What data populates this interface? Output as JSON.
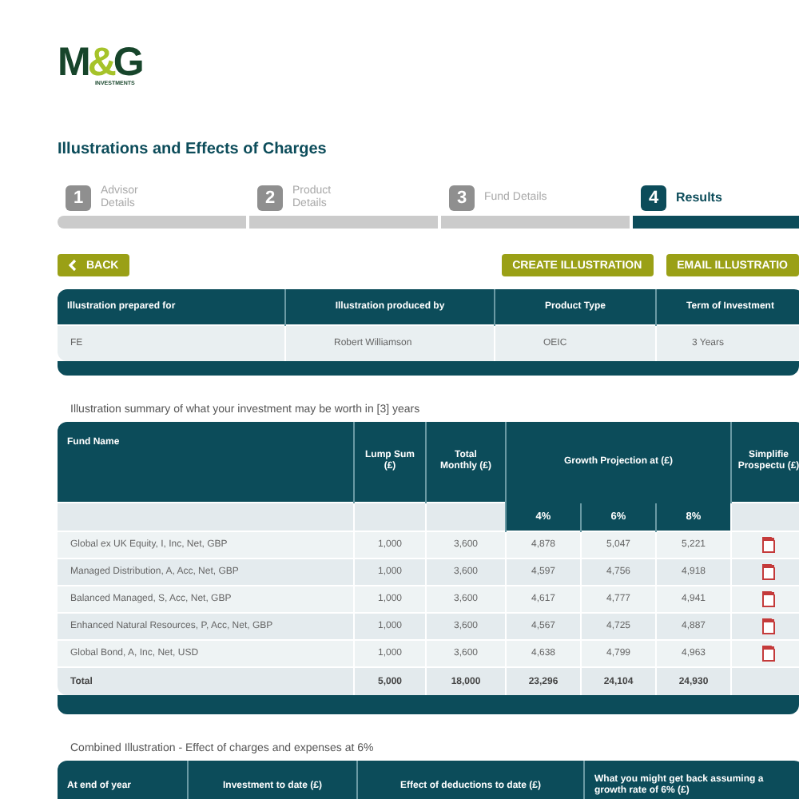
{
  "logo": {
    "letters": [
      {
        "text": "M",
        "accent": false
      },
      {
        "text": "&",
        "accent": true
      },
      {
        "text": "G",
        "accent": false
      }
    ],
    "subtitle": "INVESTMENTS"
  },
  "page_title": "Illustrations and Effects of Charges",
  "steps": [
    {
      "number": "1",
      "label": "Advisor Details",
      "selected": false
    },
    {
      "number": "2",
      "label": "Product Details",
      "selected": false
    },
    {
      "number": "3",
      "label": "Fund Details",
      "selected": false
    },
    {
      "number": "4",
      "label": "Results",
      "selected": true
    }
  ],
  "actions": {
    "back": "BACK",
    "buttons": [
      "CREATE ILLUSTRATION",
      "EMAIL ILLUSTRATIO"
    ]
  },
  "info_table": {
    "columns": [
      "Illustration prepared for",
      "Illustration produced by",
      "Product Type",
      "Term of Investment"
    ],
    "row": [
      "FE",
      "Robert Williamson",
      "OEIC",
      "3 Years"
    ]
  },
  "summary": {
    "caption": "Illustration summary of what your investment may be worth in [3] years",
    "columns": [
      {
        "label": "Fund Name"
      },
      {
        "label": "Lump Sum (£)"
      },
      {
        "label": "Total Monthly (£)"
      },
      {
        "label": "Growth Projection at (£)",
        "colspan": 3
      },
      {
        "label": "Simplifie Prospectu (£)"
      }
    ],
    "growth_rates": [
      "4%",
      "6%",
      "8%"
    ],
    "rows": [
      [
        "Global ex UK Equity, I, Inc, Net, GBP",
        "1,000",
        "3,600",
        "4,878",
        "5,047",
        "5,221"
      ],
      [
        "Managed Distribution, A, Acc, Net, GBP",
        "1,000",
        "3,600",
        "4,597",
        "4,756",
        "4,918"
      ],
      [
        "Balanced Managed, S, Acc, Net, GBP",
        "1,000",
        "3,600",
        "4,617",
        "4,777",
        "4,941"
      ],
      [
        "Enhanced Natural Resources, P, Acc, Net, GBP",
        "1,000",
        "3,600",
        "4,567",
        "4,725",
        "4,887"
      ],
      [
        "Global Bond, A, Inc, Net, USD",
        "1,000",
        "3,600",
        "4,638",
        "4,799",
        "4,963"
      ]
    ],
    "total": [
      "Total",
      "5,000",
      "18,000",
      "23,296",
      "24,104",
      "24,930"
    ]
  },
  "combined": {
    "caption": "Combined Illustration - Effect of charges and expenses at 6%",
    "columns": [
      "At end of year",
      "Investment to date (£)",
      "Effect of deductions to date (£)",
      "What you might get back assuming a growth rate of 6% (£)"
    ]
  }
}
